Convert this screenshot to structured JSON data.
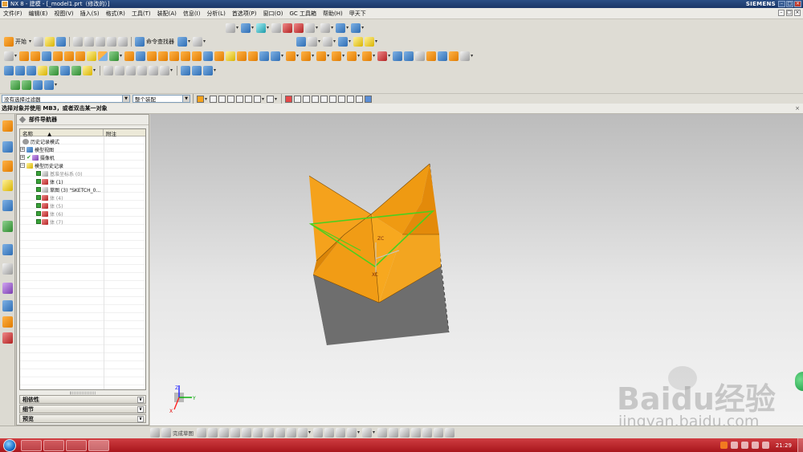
{
  "window": {
    "title": "NX 8 - 建模 - [_model1.prt（修改的）]",
    "brand": "SIEMENS"
  },
  "menubar": {
    "items": [
      "文件(F)",
      "编辑(E)",
      "视图(V)",
      "插入(S)",
      "格式(R)",
      "工具(T)",
      "装配(A)",
      "信息(I)",
      "分析(L)",
      "首选项(P)",
      "窗口(O)",
      "GC 工具箱",
      "帮助(H)",
      "甲天下"
    ]
  },
  "toolbar": {
    "start_label": "开始",
    "command_finder_label": "命令查找器"
  },
  "selection": {
    "filter_value": "没有选择过滤器",
    "scope_value": "整个装配"
  },
  "prompt": {
    "text": "选择对象并使用 MB3，或者双击某一对象"
  },
  "navigator": {
    "title": "部件导航器",
    "columns": [
      "名称",
      "附注"
    ],
    "sort_glyph": "▲",
    "rows": [
      {
        "label": "历史记录模式",
        "indent": 0,
        "dim": false
      },
      {
        "label": "模型视图",
        "indent": 0,
        "dim": false
      },
      {
        "label": "摄像机",
        "indent": 0,
        "dim": false
      },
      {
        "label": "模型历史记录",
        "indent": 0,
        "dim": false
      },
      {
        "label": "基准坐标系 (0)",
        "indent": 1,
        "dim": true
      },
      {
        "label": "体 (1)",
        "indent": 1,
        "dim": false
      },
      {
        "label": "草图 (3) \"SKETCH_0...",
        "indent": 1,
        "dim": false
      },
      {
        "label": "体 (4)",
        "indent": 1,
        "dim": true
      },
      {
        "label": "体 (5)",
        "indent": 1,
        "dim": true
      },
      {
        "label": "体 (6)",
        "indent": 1,
        "dim": true
      },
      {
        "label": "体 (7)",
        "indent": 1,
        "dim": true
      }
    ],
    "sections": [
      "相依性",
      "细节",
      "预览"
    ]
  },
  "bottombar": {
    "sketch_label": "完成草图"
  },
  "triad": {
    "x": "X",
    "y": "Y",
    "z": "Z"
  },
  "model_axes": {
    "zc": "ZC",
    "xc": "XC"
  },
  "watermark": {
    "logo": "Baidu经验",
    "url": "jingyan.baidu.com"
  },
  "taskbar": {
    "clock": "21:29"
  },
  "colors": {
    "body_orange": "#f5a21c",
    "body_orange_dark": "#d98608",
    "body_gray": "#707070",
    "sketch_green": "#49d01f",
    "taskbar_red": "#b8232a"
  }
}
